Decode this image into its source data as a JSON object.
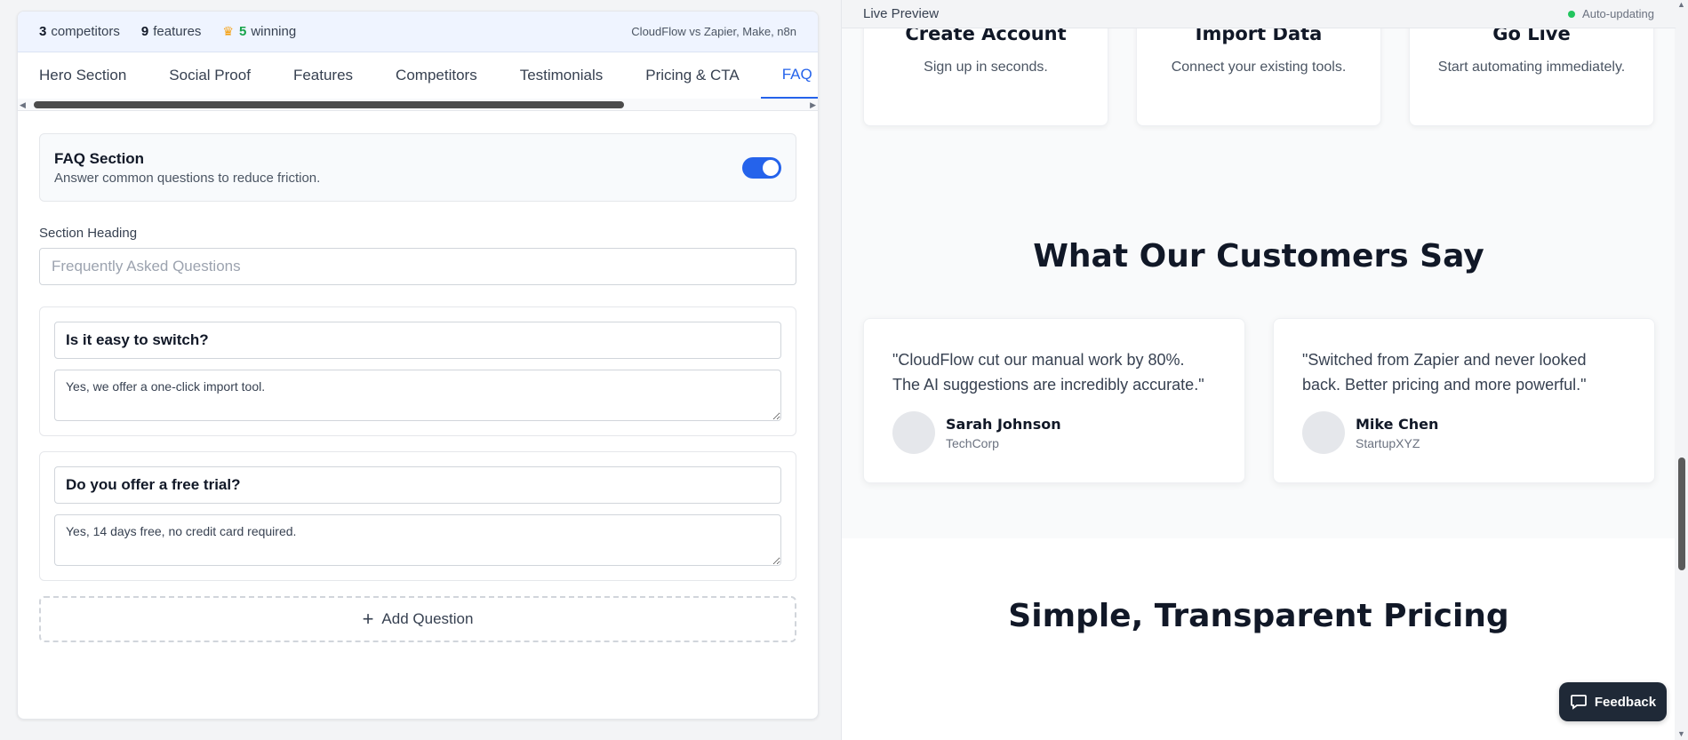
{
  "stats": {
    "competitors_count": "3",
    "competitors_label": "competitors",
    "features_count": "9",
    "features_label": "features",
    "winning_count": "5",
    "winning_label": "winning",
    "comparison": "CloudFlow vs Zapier, Make, n8n"
  },
  "tabs": [
    {
      "label": "Hero Section"
    },
    {
      "label": "Social Proof"
    },
    {
      "label": "Features"
    },
    {
      "label": "Competitors"
    },
    {
      "label": "Testimonials"
    },
    {
      "label": "Pricing & CTA"
    },
    {
      "label": "FAQ"
    }
  ],
  "active_tab": "FAQ",
  "faq_section": {
    "title": "FAQ Section",
    "subtitle": "Answer common questions to reduce friction.",
    "enabled": true,
    "heading_label": "Section Heading",
    "heading_placeholder": "Frequently Asked Questions",
    "items": [
      {
        "question": "Is it easy to switch?",
        "answer": "Yes, we offer a one-click import tool."
      },
      {
        "question": "Do you offer a free trial?",
        "answer": "Yes, 14 days free, no credit card required."
      }
    ],
    "add_label": "Add Question"
  },
  "preview": {
    "header": "Live Preview",
    "status": "Auto-updating",
    "steps": [
      {
        "title": "Create Account",
        "desc": "Sign up in seconds."
      },
      {
        "title": "Import Data",
        "desc": "Connect your existing tools."
      },
      {
        "title": "Go Live",
        "desc": "Start automating immediately."
      }
    ],
    "testimonials_title": "What Our Customers Say",
    "testimonials": [
      {
        "quote": "\"CloudFlow cut our manual work by 80%. The AI suggestions are incredibly accurate.\"",
        "name": "Sarah Johnson",
        "company": "TechCorp"
      },
      {
        "quote": "\"Switched from Zapier and never looked back. Better pricing and more powerful.\"",
        "name": "Mike Chen",
        "company": "StartupXYZ"
      }
    ],
    "pricing_title": "Simple, Transparent Pricing"
  },
  "feedback_label": "Feedback",
  "colors": {
    "accent": "#2563eb",
    "winning": "#16a34a",
    "status_dot": "#22c55e",
    "feedback_bg": "#1f2937"
  }
}
